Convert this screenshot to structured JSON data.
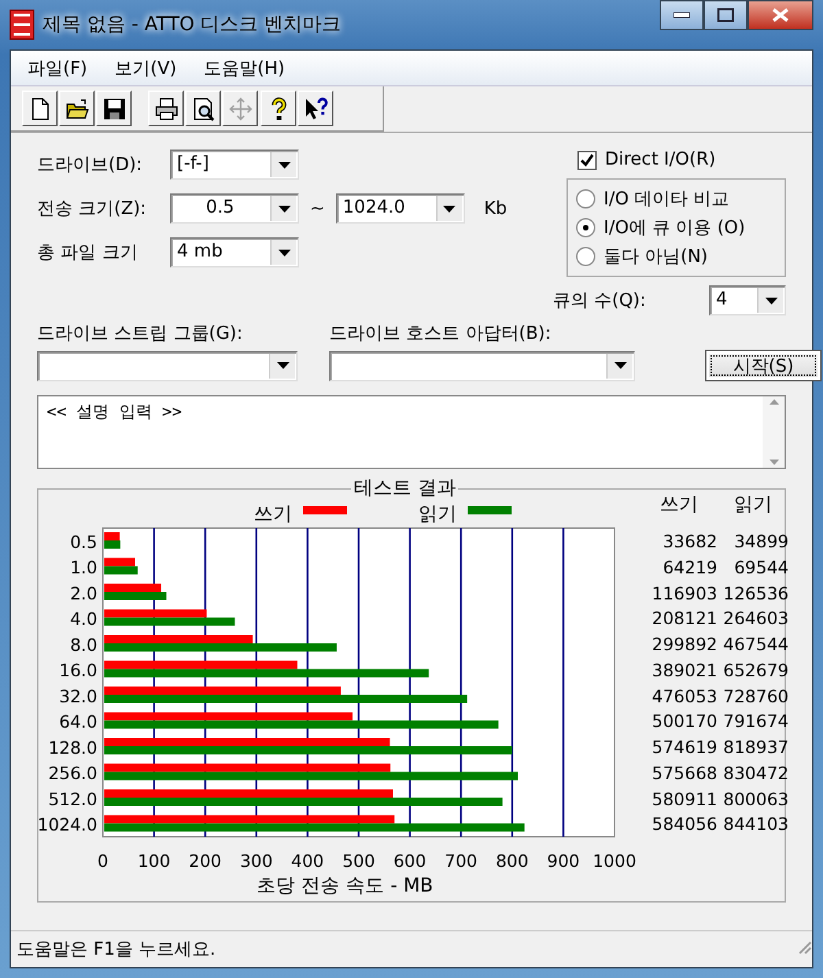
{
  "window": {
    "title": "제목 없음 - ATTO 디스크 벤치마크"
  },
  "menu": [
    "파일(F)",
    "보기(V)",
    "도움말(H)"
  ],
  "toolbar": [
    {
      "kind": "new",
      "disabled": false
    },
    {
      "kind": "open",
      "disabled": false
    },
    {
      "kind": "save",
      "disabled": false
    },
    {
      "kind": "print",
      "disabled": false
    },
    {
      "kind": "preview",
      "disabled": false
    },
    {
      "kind": "move",
      "disabled": true
    },
    {
      "kind": "help",
      "disabled": false
    },
    {
      "kind": "context_help",
      "disabled": false
    }
  ],
  "drive": {
    "label": "드라이브(D):",
    "value": "[-f-]"
  },
  "transfer_size": {
    "label": "전송 크기(Z):",
    "from": "0.5",
    "separator": "~",
    "to": "1024.0",
    "unit": "Kb"
  },
  "total_file_size": {
    "label": "총 파일 크기",
    "value": "4 mb"
  },
  "direct_io": {
    "label": "Direct I/O(R)",
    "checked": true
  },
  "io_modes": [
    {
      "label": "I/O 데이타 비교",
      "selected": false
    },
    {
      "label": "I/O에 큐 이용 (O)",
      "selected": true
    },
    {
      "label": "둘다 아님(N)",
      "selected": false
    }
  ],
  "queue_depth": {
    "label": "큐의 수(Q):",
    "value": "4"
  },
  "stripe_group": {
    "label": "드라이브 스트립 그룹(G):"
  },
  "host_adapter": {
    "label": "드라이브 호스트 아답터(B):"
  },
  "start_button": "시작(S)",
  "description": {
    "value": "<< 설명 입력 >>"
  },
  "results": {
    "title": "테스트 결과",
    "chart_data": {
      "type": "bar",
      "orientation": "horizontal",
      "xlabel": "초당 전송 속도 - MB",
      "categories": [
        "0.5",
        "1.0",
        "2.0",
        "4.0",
        "8.0",
        "16.0",
        "32.0",
        "64.0",
        "128.0",
        "256.0",
        "512.0",
        "1024.0"
      ],
      "series": [
        {
          "name": "쓰기",
          "color": "#ff0000",
          "values": [
            33,
            63,
            114,
            203,
            293,
            380,
            465,
            488,
            561,
            562,
            567,
            570
          ]
        },
        {
          "name": "읽기",
          "color": "#008000",
          "values": [
            34,
            68,
            124,
            258,
            457,
            637,
            712,
            773,
            800,
            811,
            781,
            824
          ]
        }
      ],
      "grid": true,
      "legend": true,
      "xlim": [
        0,
        1000
      ],
      "xticks": [
        0,
        100,
        200,
        300,
        400,
        500,
        600,
        700,
        800,
        900,
        1000
      ]
    },
    "table": {
      "columns": [
        "쓰기",
        "읽기"
      ],
      "rows": [
        [
          "33682",
          "34899"
        ],
        [
          "64219",
          "69544"
        ],
        [
          "116903",
          "126536"
        ],
        [
          "208121",
          "264603"
        ],
        [
          "299892",
          "467544"
        ],
        [
          "389021",
          "652679"
        ],
        [
          "476053",
          "728760"
        ],
        [
          "500170",
          "791674"
        ],
        [
          "574619",
          "818937"
        ],
        [
          "575668",
          "830472"
        ],
        [
          "580911",
          "800063"
        ],
        [
          "584056",
          "844103"
        ]
      ]
    }
  },
  "status_bar": "도움말은 F1을 누르세요."
}
